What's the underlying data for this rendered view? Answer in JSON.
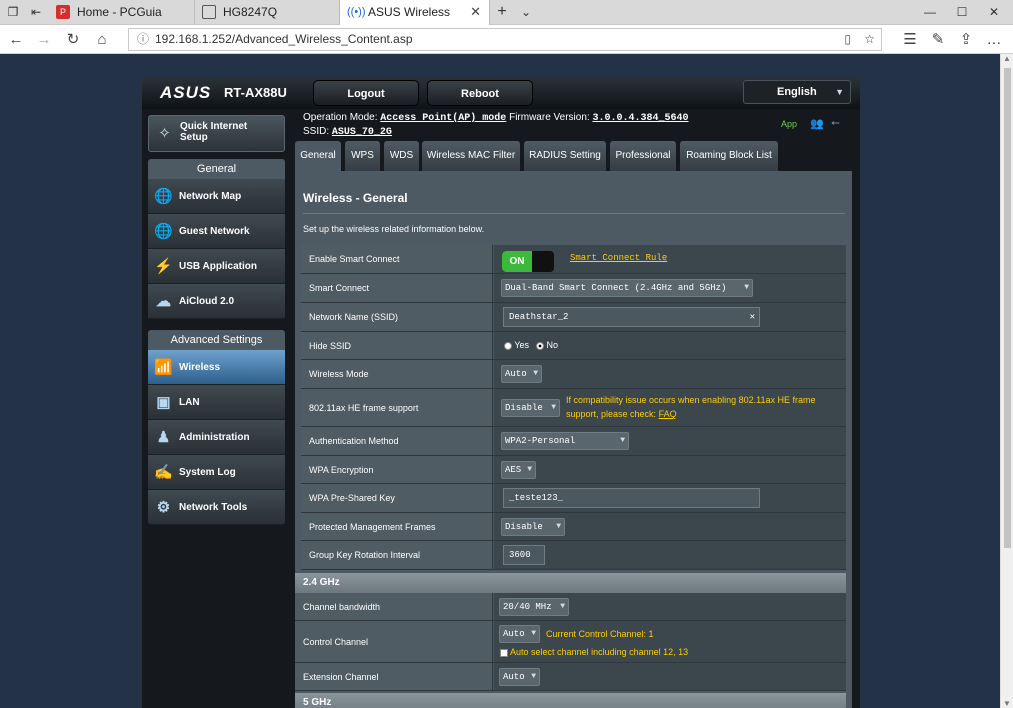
{
  "browser": {
    "tabs": [
      {
        "label": "Home - PCGuia"
      },
      {
        "label": "HG8247Q"
      },
      {
        "label": "ASUS Wireless Router R"
      }
    ],
    "url": "192.168.1.252/Advanced_Wireless_Content.asp"
  },
  "router": {
    "brand": "ASUS",
    "model": "RT-AX88U",
    "logout_label": "Logout",
    "reboot_label": "Reboot",
    "language": "English",
    "op_mode_label": "Operation Mode:",
    "op_mode_value": "Access Point(AP) mode",
    "fw_label": "Firmware Version:",
    "fw_value": "3.0.0.4.384_5640",
    "ssid_label": "SSID:",
    "ssid_value": "ASUS_70_2G",
    "app_label": "App"
  },
  "sidebar": {
    "quick_setup": "Quick Internet Setup",
    "general_header": "General",
    "general_items": [
      {
        "label": "Network Map",
        "icon": "globe-icon"
      },
      {
        "label": "Guest Network",
        "icon": "globe-icon"
      },
      {
        "label": "USB Application",
        "icon": "usb-icon"
      },
      {
        "label": "AiCloud 2.0",
        "icon": "cloud-icon"
      }
    ],
    "advanced_header": "Advanced Settings",
    "advanced_items": [
      {
        "label": "Wireless",
        "icon": "wireless-icon"
      },
      {
        "label": "LAN",
        "icon": "lan-icon"
      },
      {
        "label": "Administration",
        "icon": "admin-icon"
      },
      {
        "label": "System Log",
        "icon": "log-icon"
      },
      {
        "label": "Network Tools",
        "icon": "tools-icon"
      }
    ]
  },
  "tabs": [
    {
      "label": "General"
    },
    {
      "label": "WPS"
    },
    {
      "label": "WDS"
    },
    {
      "label": "Wireless MAC Filter"
    },
    {
      "label": "RADIUS Setting"
    },
    {
      "label": "Professional"
    },
    {
      "label": "Roaming Block List"
    }
  ],
  "content": {
    "title": "Wireless - General",
    "description": "Set up the wireless related information below.",
    "rows": {
      "smart_connect": {
        "label": "Enable Smart Connect",
        "toggle": "ON",
        "link": "Smart Connect Rule"
      },
      "smart_connect_mode": {
        "label": "Smart Connect",
        "value": "Dual-Band Smart Connect (2.4GHz and 5GHz)"
      },
      "ssid": {
        "label": "Network Name (SSID)",
        "value": "Deathstar_2"
      },
      "hide_ssid": {
        "label": "Hide SSID",
        "yes": "Yes",
        "no": "No"
      },
      "wireless_mode": {
        "label": "Wireless Mode",
        "value": "Auto"
      },
      "he_frame": {
        "label": "802.11ax HE frame support",
        "value": "Disable",
        "note": "If compatibility issue occurs when enabling 802.11ax HE frame support, please check:",
        "note_link": "FAQ"
      },
      "auth": {
        "label": "Authentication Method",
        "value": "WPA2-Personal"
      },
      "wpa_enc": {
        "label": "WPA Encryption",
        "value": "AES"
      },
      "psk": {
        "label": "WPA Pre-Shared Key",
        "value": "_teste123_"
      },
      "pmf": {
        "label": "Protected Management Frames",
        "value": "Disable"
      },
      "gkri": {
        "label": "Group Key Rotation Interval",
        "value": "3600"
      }
    },
    "band24": "2.4 GHz",
    "band24_rows": {
      "bandwidth": {
        "label": "Channel bandwidth",
        "value": "20/40 MHz"
      },
      "control": {
        "label": "Control Channel",
        "value": "Auto",
        "current": "Current Control Channel: 1",
        "auto_select": "Auto select channel including channel 12, 13"
      },
      "extension": {
        "label": "Extension Channel",
        "value": "Auto"
      }
    },
    "band5": "5 GHz"
  }
}
